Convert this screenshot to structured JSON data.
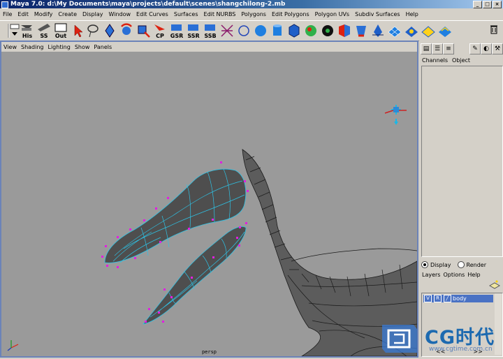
{
  "window": {
    "title": "Maya 7.0: d:\\My Documents\\maya\\projects\\default\\scenes\\shangchilong-2.mb"
  },
  "menubar": [
    "File",
    "Edit",
    "Modify",
    "Create",
    "Display",
    "Window",
    "Edit Curves",
    "Surfaces",
    "Edit NURBS",
    "Polygons",
    "Edit Polygons",
    "Polygon UVs",
    "Subdiv Surfaces",
    "Help"
  ],
  "shelf": {
    "labels": {
      "his": "His",
      "ss": "SS",
      "out": "Out",
      "cp": "CP",
      "gsr": "GSR",
      "ssr": "SSR",
      "ssb": "SSB"
    }
  },
  "panel": {
    "menu": [
      "View",
      "Shading",
      "Lighting",
      "Show",
      "Panels"
    ],
    "camera": "persp"
  },
  "channel_box": {
    "tabs": [
      "Channels",
      "Object"
    ]
  },
  "layers": {
    "display_label": "Display",
    "render_label": "Render",
    "display_selected": true,
    "menu": [
      "Layers",
      "Options",
      "Help"
    ],
    "row": {
      "v": "V",
      "r": "R",
      "name": "body"
    },
    "nav": [
      "<<",
      ">>"
    ]
  },
  "watermark": {
    "text": "CG时代",
    "url": "www.cgtime.com.cn"
  }
}
